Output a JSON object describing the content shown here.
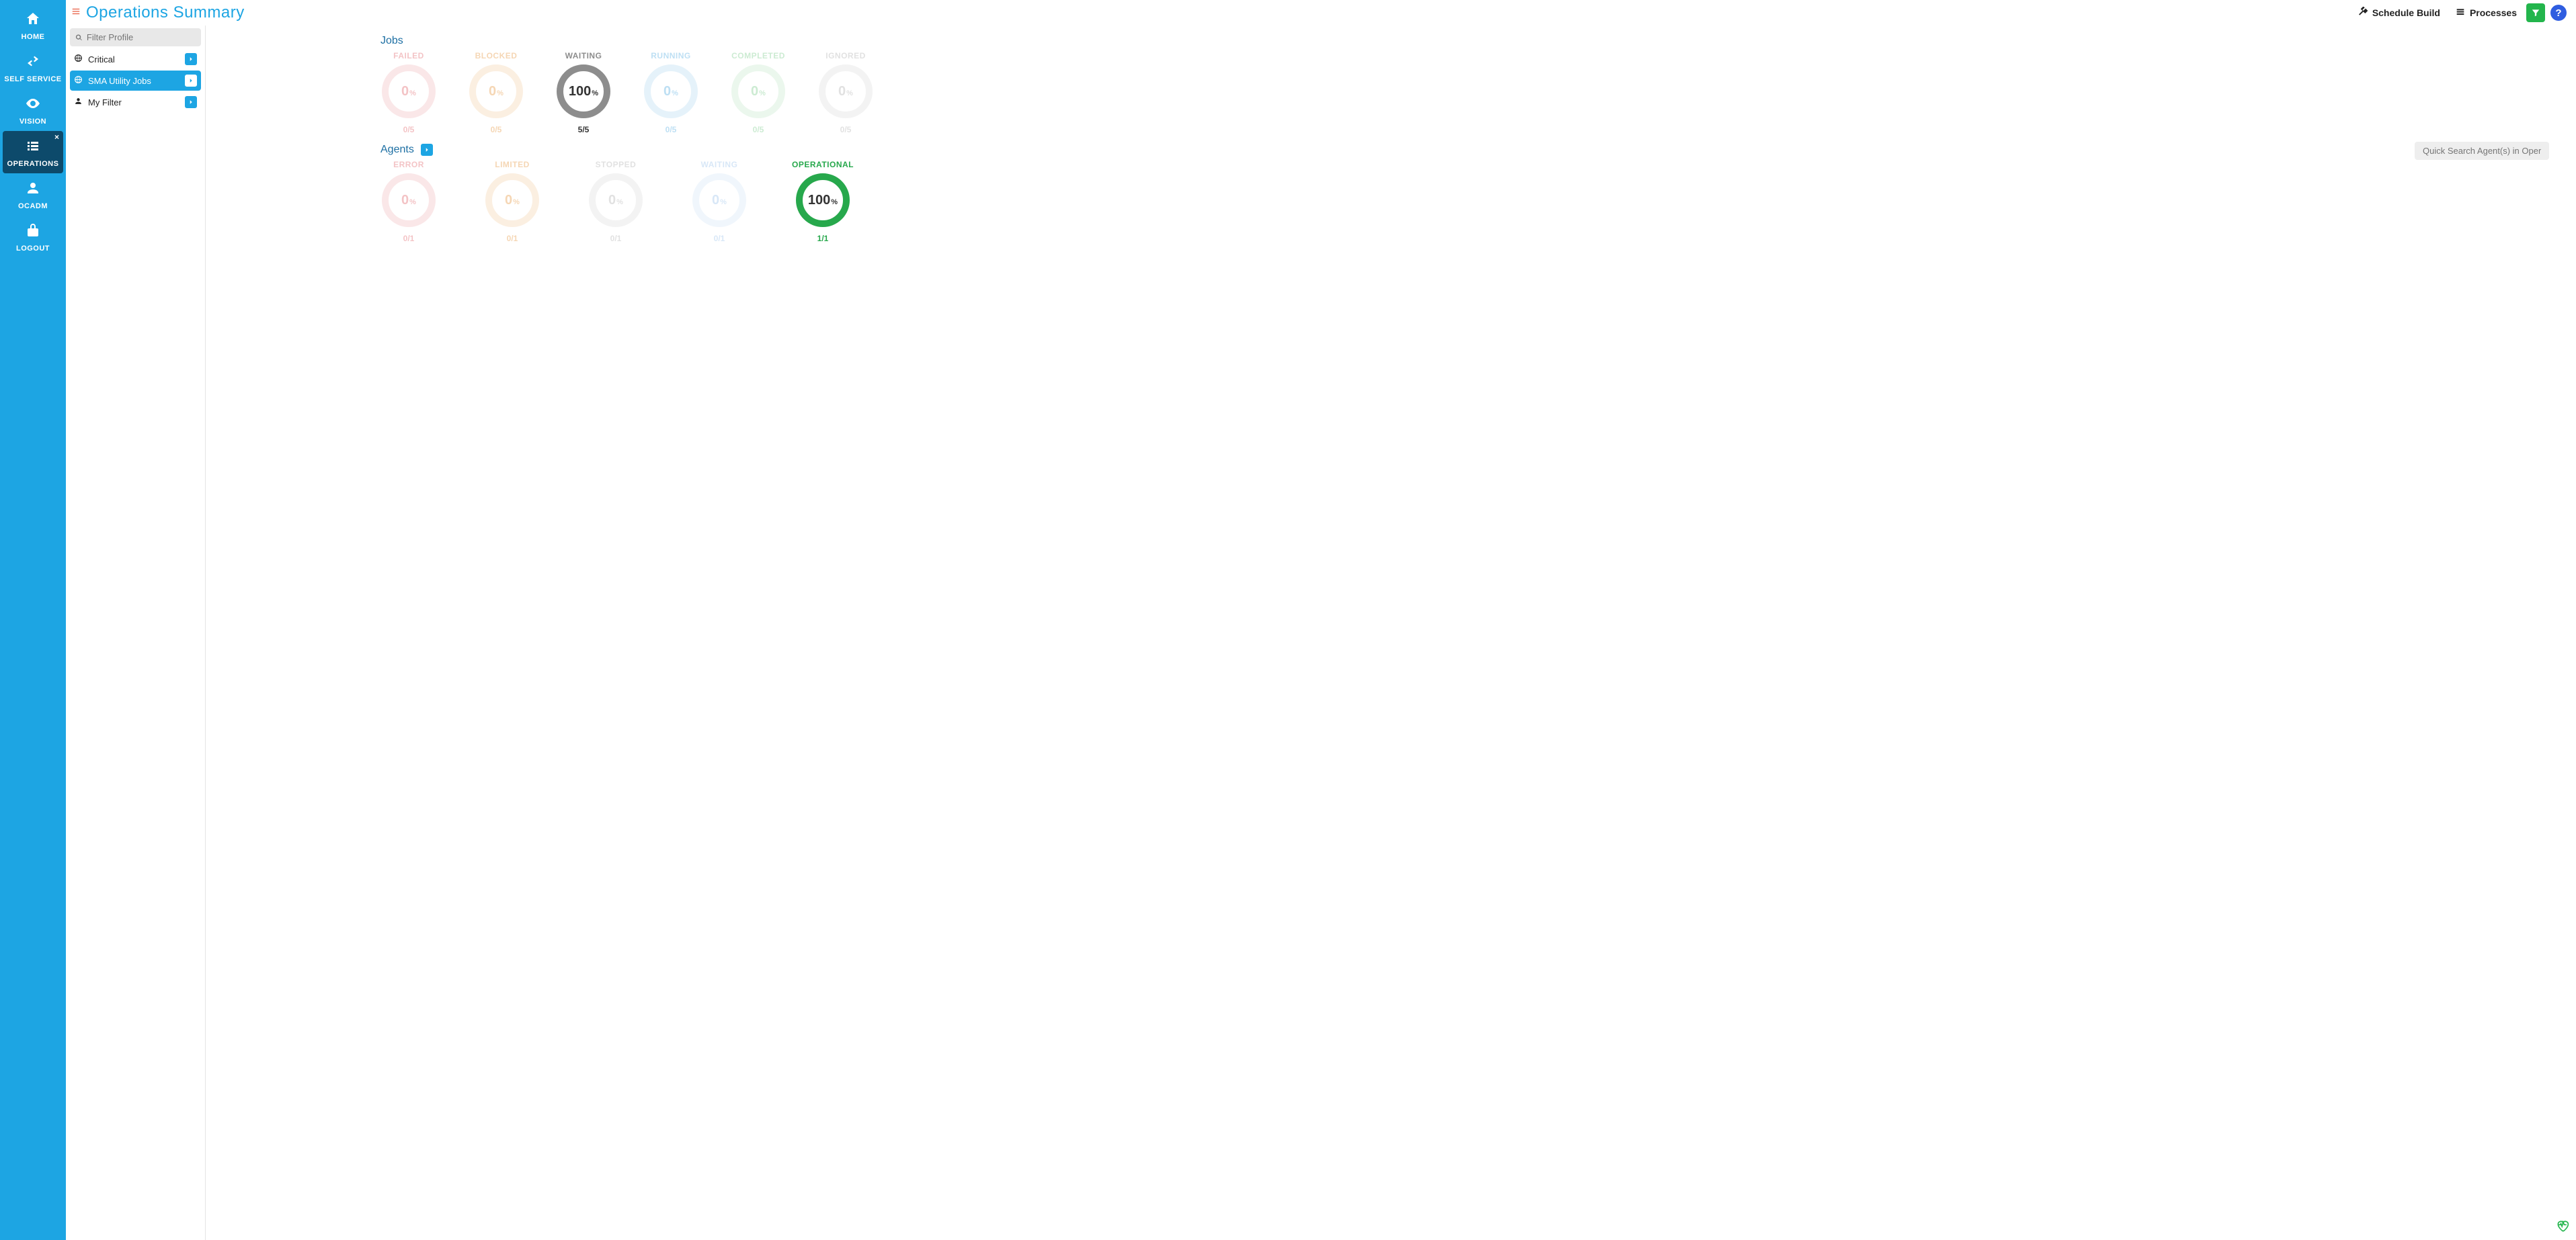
{
  "nav": {
    "items": [
      {
        "id": "home",
        "label": "HOME"
      },
      {
        "id": "self-service",
        "label": "SELF SERVICE"
      },
      {
        "id": "vision",
        "label": "VISION"
      },
      {
        "id": "operations",
        "label": "OPERATIONS",
        "active": true
      },
      {
        "id": "ocadm",
        "label": "OCADM"
      },
      {
        "id": "logout",
        "label": "LOGOUT"
      }
    ]
  },
  "header": {
    "title": "Operations Summary",
    "schedule_build": "Schedule Build",
    "processes": "Processes"
  },
  "filter": {
    "placeholder": "Filter Profile",
    "profiles": [
      {
        "label": "Critical",
        "icon": "globe",
        "selected": false
      },
      {
        "label": "SMA Utility Jobs",
        "icon": "globe",
        "selected": true
      },
      {
        "label": "My Filter",
        "icon": "user",
        "selected": false
      }
    ]
  },
  "jobs": {
    "title": "Jobs",
    "tiles": [
      {
        "label": "FAILED",
        "pct": 0,
        "count": "0/5",
        "color": "#e67b80",
        "active": false
      },
      {
        "label": "BLOCKED",
        "pct": 0,
        "count": "0/5",
        "color": "#e9a55a",
        "active": false
      },
      {
        "label": "WAITING",
        "pct": 100,
        "count": "5/5",
        "color": "#8d8d8d",
        "active": true
      },
      {
        "label": "RUNNING",
        "pct": 0,
        "count": "0/5",
        "color": "#6fb9e6",
        "active": false
      },
      {
        "label": "COMPLETED",
        "pct": 0,
        "count": "0/5",
        "color": "#8fd39d",
        "active": false
      },
      {
        "label": "IGNORED",
        "pct": 0,
        "count": "0/5",
        "color": "#bdbdbd",
        "active": false
      }
    ]
  },
  "agents": {
    "title": "Agents",
    "search_placeholder": "Quick Search Agent(s) in Operations",
    "tiles": [
      {
        "label": "ERROR",
        "pct": 0,
        "count": "0/1",
        "color": "#e67b80",
        "active": false
      },
      {
        "label": "LIMITED",
        "pct": 0,
        "count": "0/1",
        "color": "#e9a55a",
        "active": false
      },
      {
        "label": "STOPPED",
        "pct": 0,
        "count": "0/1",
        "color": "#bdbdbd",
        "active": false
      },
      {
        "label": "WAITING",
        "pct": 0,
        "count": "0/1",
        "color": "#aaccee",
        "active": false
      },
      {
        "label": "OPERATIONAL",
        "pct": 100,
        "count": "1/1",
        "color": "#27a84c",
        "active": true
      }
    ]
  },
  "pct_suffix": "%"
}
